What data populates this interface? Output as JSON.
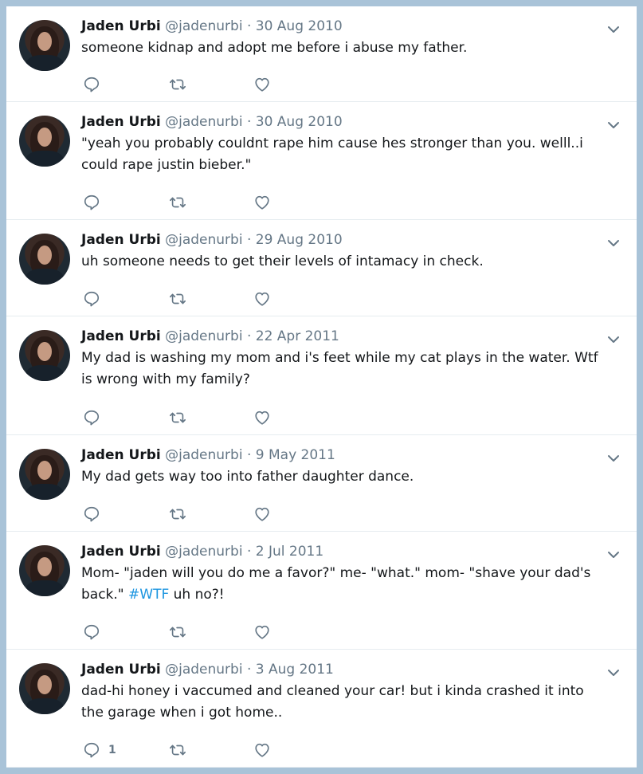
{
  "tweets": [
    {
      "name": "Jaden Urbi",
      "meta": "@jadenurbi · 30 Aug 2010",
      "text": "someone kidnap and adopt me before i abuse my father.",
      "text_lines": 1,
      "reply_count": ""
    },
    {
      "name": "Jaden Urbi",
      "meta": "@jadenurbi · 30 Aug 2010",
      "text": "\"yeah you probably couldnt rape him cause hes stronger than you. welll..i could rape justin bieber.\"",
      "text_lines": 2,
      "reply_count": ""
    },
    {
      "name": "Jaden Urbi",
      "meta": "@jadenurbi · 29 Aug 2010",
      "text": "uh someone needs to get their levels of intamacy in check.",
      "text_lines": 1,
      "reply_count": ""
    },
    {
      "name": "Jaden Urbi",
      "meta": "@jadenurbi · 22 Apr 2011",
      "text": "My dad is washing my mom and i's feet while my cat plays in the water. Wtf is wrong with my family?",
      "text_lines": 2,
      "reply_count": ""
    },
    {
      "name": "Jaden Urbi",
      "meta": "@jadenurbi · 9 May 2011",
      "text": "My dad gets way too into father daughter dance.",
      "text_lines": 1,
      "reply_count": ""
    },
    {
      "name": "Jaden Urbi",
      "meta": "@jadenurbi · 2 Jul 2011",
      "text_before": "Mom- \"jaden will you do me a favor?\" me- \"what.\" mom- \"shave your dad's back.\" ",
      "hashtag": "#WTF",
      "text_after": " uh no?!",
      "text_lines": 2,
      "reply_count": ""
    },
    {
      "name": "Jaden Urbi",
      "meta": "@jadenurbi · 3 Aug 2011",
      "text": "dad-hi honey i vaccumed and cleaned your car! but i kinda crashed it into the garage when i got home..",
      "text_lines": 2,
      "reply_count": "1"
    }
  ],
  "colors": {
    "icon": "#657786",
    "hashtag": "#1b95e0",
    "frame": "#a9c3d8"
  },
  "icons": [
    "reply-icon",
    "retweet-icon",
    "like-icon",
    "chevron-down-icon"
  ]
}
